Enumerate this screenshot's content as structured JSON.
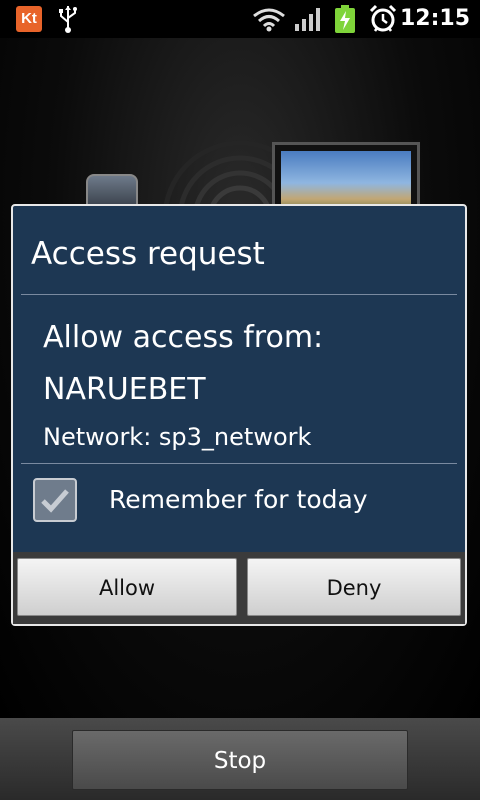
{
  "status_bar": {
    "carrier_icon_text": "Kt",
    "time": "12:15",
    "icons": [
      "kt-notification-icon",
      "usb-icon",
      "wifi-icon",
      "signal-icon",
      "battery-charging-icon",
      "alarm-icon"
    ]
  },
  "dialog": {
    "title": "Access request",
    "allow_from_label": "Allow access from:",
    "device_name": "NARUEBET",
    "network_text": "Network: sp3_network",
    "remember": {
      "label": "Remember for today",
      "checked": true
    },
    "allow_label": "Allow",
    "deny_label": "Deny"
  },
  "bottom": {
    "stop_label": "Stop"
  },
  "colors": {
    "dialog_bg": "#1d3753",
    "kt_orange": "#e8642a",
    "battery_green": "#7fd43a"
  }
}
